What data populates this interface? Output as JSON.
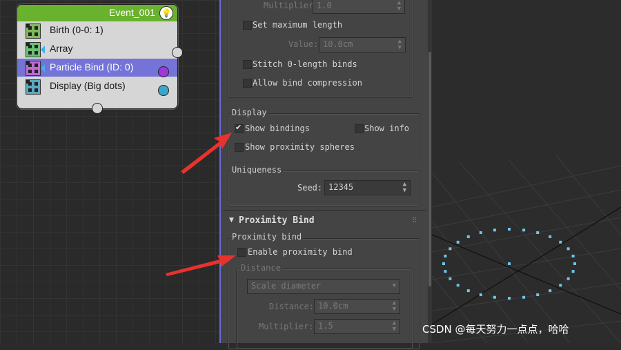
{
  "event": {
    "title": "Event_001",
    "operators": [
      {
        "label": "Birth (0-0: 1)",
        "icon": "birth-icon"
      },
      {
        "label": "Array",
        "icon": "array-icon"
      },
      {
        "label": "Particle Bind (ID: 0)",
        "icon": "particle-bind-icon"
      },
      {
        "label": "Display (Big dots)",
        "icon": "display-icon"
      }
    ]
  },
  "panel": {
    "top_group": {
      "multiplier_label": "Multiplier:",
      "multiplier_value": "1.0",
      "set_max_length": "Set maximum length",
      "value_label": "Value:",
      "value_value": "10.0cm",
      "stitch": "Stitch 0-length binds",
      "allow_compression": "Allow bind compression"
    },
    "display": {
      "title": "Display",
      "show_bindings": "Show bindings",
      "show_info": "Show info",
      "show_proximity": "Show proximity spheres"
    },
    "uniqueness": {
      "title": "Uniqueness",
      "seed_label": "Seed:",
      "seed_value": "12345"
    },
    "proximity_rollout": {
      "title": "Proximity Bind",
      "group_title": "Proximity bind",
      "enable": "Enable proximity bind",
      "distance_title": "Distance",
      "dropdown_value": "Scale diameter",
      "distance_label": "Distance:",
      "distance_value": "10.0cm",
      "multiplier_label": "Multiplier:",
      "multiplier_value": "1.5"
    }
  },
  "watermark": "CSDN @每天努力一点点，哈哈",
  "colors": {
    "event_header": "#69b22e",
    "selected_row": "#7373d8",
    "arrow": "#e8322e",
    "particle_dots": "#6fc6e8"
  }
}
